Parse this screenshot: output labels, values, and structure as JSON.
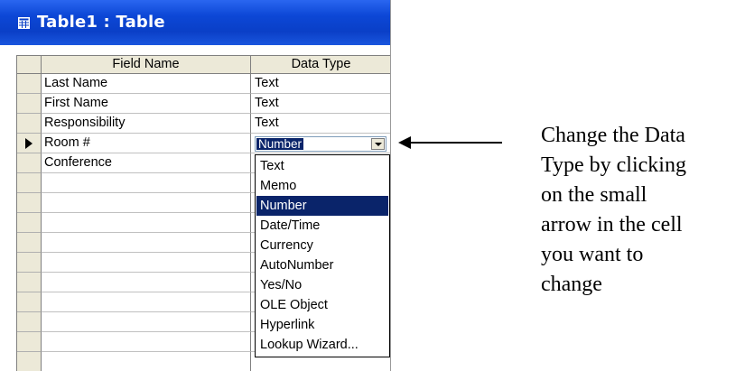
{
  "window": {
    "title": "Table1 : Table",
    "title_icon": "table-icon",
    "title_color": "#0a3fc7"
  },
  "grid": {
    "columns": [
      "Field Name",
      "Data Type"
    ],
    "rows": [
      {
        "field": "Last Name",
        "type": "Text"
      },
      {
        "field": "First Name",
        "type": "Text"
      },
      {
        "field": "Responsibility",
        "type": "Text"
      },
      {
        "field": "Room #",
        "type": "Number",
        "current": true
      },
      {
        "field": "Conference",
        "type": ""
      }
    ],
    "current_row_icon": "row-pointer-icon"
  },
  "dropdown": {
    "options": [
      "Text",
      "Memo",
      "Number",
      "Date/Time",
      "Currency",
      "AutoNumber",
      "Yes/No",
      "OLE Object",
      "Hyperlink",
      "Lookup Wizard..."
    ],
    "selected": "Number",
    "selection_color": "#0a246a"
  },
  "annotation": {
    "lines": [
      "Change the Data",
      "Type by clicking",
      "on the small",
      "arrow in the cell",
      "you want to",
      "change"
    ],
    "arrow_icon": "left-arrow-icon"
  }
}
